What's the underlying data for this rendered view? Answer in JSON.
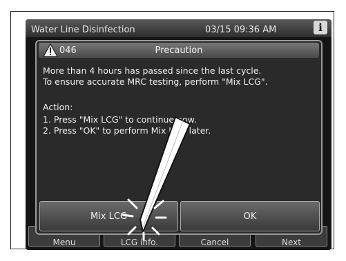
{
  "header": {
    "title": "Water Line Disinfection",
    "datetime": "03/15 09:36 AM",
    "info_icon": "i"
  },
  "bottom_bar": {
    "buttons": [
      "Menu",
      "LCG info.",
      "Cancel",
      "Next"
    ]
  },
  "dialog": {
    "code": "046",
    "title": "Precaution",
    "message_lines": [
      "More than 4 hours has passed since the last cycle.",
      "To ensure accurate MRC testing, perform \"Mix LCG\"."
    ],
    "action_label": "Action:",
    "action_lines": [
      "1. Press \"Mix LCG\" to continue now.",
      "2. Press \"OK\" to perform Mix LCG later."
    ],
    "buttons": {
      "mix_lcg": "Mix LCG",
      "ok": "OK"
    }
  },
  "colors": {
    "screen_bg": "#151515",
    "dialog_bg": "#2a2a2a",
    "text": "#f2f2f2"
  }
}
